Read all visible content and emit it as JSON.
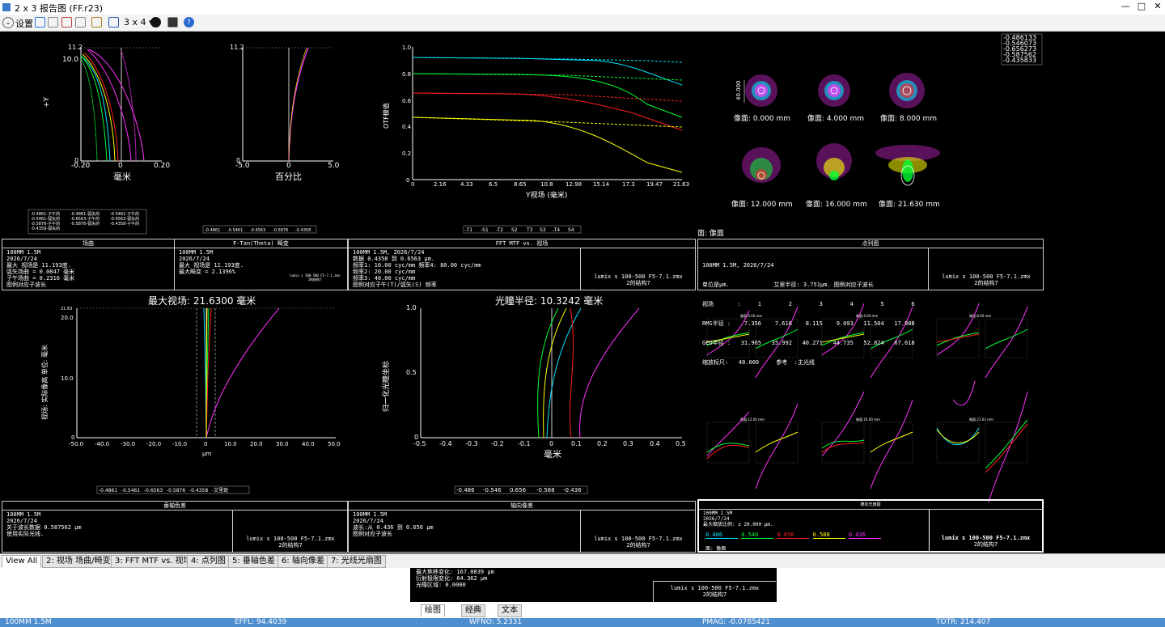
{
  "window": {
    "title": "2 x 3 报告图 (FF.r23)",
    "min": "—",
    "max": "□",
    "close": "✕"
  },
  "toolbar": {
    "settings": "设置",
    "layout": "3 x 4 ▾"
  },
  "p_fc": {
    "ytop": "11.2",
    "y10": "10.0",
    "y0": "0",
    "ylabel": "+Y",
    "xl": "-0.20",
    "xm": "0",
    "xr": "0.20",
    "xunit": "毫米",
    "legend": [
      "-0.4861-子午的",
      "-0.4861-弧矢的",
      "-0.5461-子午的",
      "-0.5461-弧矢的",
      "-0.6563-子午的",
      "-0.6563-弧矢的",
      "-0.5876-子午的",
      "-0.5876-弧矢的",
      "-0.4358-子午的",
      "-0.4358-弧矢的"
    ]
  },
  "p_dist": {
    "ytop": "11.2",
    "y0": "0",
    "xl": "-5.0",
    "xm": "0",
    "xr": "5.0",
    "xunit": "百分比",
    "legend": [
      "-0.4861",
      "-0.5461",
      "-0.6563",
      "-0.5876",
      "-0.4358"
    ]
  },
  "p_mtf": {
    "yticks": [
      "1.0",
      "0.8",
      "0.6",
      "0.4",
      "0.2",
      "0"
    ],
    "xticks": [
      "0",
      "2.16",
      "4.33",
      "6.5",
      "8.65",
      "10.8",
      "12.98",
      "15.14",
      "17.3",
      "19.47",
      "21.63"
    ],
    "ylabel": "OTF模值",
    "xlabel": "Y视场 (毫米)",
    "legend": [
      "-T1",
      "-S1",
      "-T2",
      "S2",
      "T3",
      "S3",
      "-T4",
      "S4"
    ]
  },
  "p_spot": {
    "wavelegend": [
      "-0.486133",
      "-0.546073",
      "-0.656273",
      "-0.587562",
      "-0.435833"
    ],
    "scale": "40.000",
    "fields": [
      "像面: 0.000 mm",
      "像面: 4.000 mm",
      "像面: 8.000 mm",
      "像面: 12.000 mm",
      "像面: 16.000 mm",
      "像面: 21.630 mm"
    ],
    "surface_label": "面: 像面"
  },
  "info_fc": {
    "head1": "场曲",
    "head2": "F-Tan(Theta) 畸变",
    "left": [
      "100MM 1.5M",
      "2026/7/24",
      "最大 视场是 11.193度.",
      "弧矢场曲 = 0.0847 毫米",
      "子午场曲 = 0.2316 毫米",
      "图例对应子波长"
    ],
    "right": [
      "100MM 1.5M",
      "2026/7/24",
      "最大 视场是 11.193度.",
      "最大畸变 = 2.1396%"
    ],
    "lens": "lumix s 100-500 F5-7.1.zmx",
    "config": "2的结构7"
  },
  "info_mtf": {
    "head": "FFT MTF vs. 视场",
    "lines": [
      "100MM 1.5M, 2026/7/24",
      "数据 0.4358 到 0.6563 μm.",
      "频率1:   10.00 cyc/mm  频率4:   80.00 cyc/mm",
      "频率2:   20.00 cyc/mm",
      "频率3:   40.00 cyc/mm",
      "图例对应子午(T)/弧矢(S) 频率"
    ],
    "lens": "lumix s 100-500 F5-7.1.zmx",
    "config": "2的结构7"
  },
  "info_spot": {
    "head": "点列图",
    "lines": [
      "100MM 1.5M, 2026/7/24",
      "单位是μm.             艾里半径: 3.751μm. 图例对应子波长",
      "视场       :     1        2        3        4        5        6",
      "RMS半径 :    7.356    7.616    8.115    9.093   11.504   17.988",
      "GEO半径 :   31.965   35.992   40.271   44.735   52.824   67.618",
      "缩放标尺:   40.000     参考  :主光线"
    ],
    "lens": "lumix s 100-500 F5-7.1.zmx",
    "config": "2的结构7"
  },
  "p_lat": {
    "title": "最大视场: 21.6300 毫米",
    "ytop": "21.63",
    "y20": "20.0",
    "y10": "10.0",
    "y0": "0",
    "ylabel": "视场: 实际像高 单位: 毫米",
    "xticks": [
      "-50.0",
      "-40.0",
      "-30.0",
      "-20.0",
      "-10.0",
      "0",
      "10.0",
      "20.0",
      "30.0",
      "40.0",
      "50.0"
    ],
    "xunit": "μm",
    "legend": [
      "-0.4861",
      "-0.5461",
      "-0.6563",
      "-0.5876",
      "-0.4358",
      "-艾里斑"
    ]
  },
  "p_axial": {
    "title": "光瞳半径: 10.3242 毫米",
    "yticks": [
      "1.0",
      "0.5",
      "0"
    ],
    "ylabel": "归一化光瞳坐标",
    "xticks": [
      "-0.5",
      "-0.4",
      "-0.3",
      "-0.2",
      "-0.1",
      "0",
      "0.1",
      "0.2",
      "0.3",
      "0.4",
      "0.5"
    ],
    "xunit": "毫米",
    "legend": [
      "-0.486",
      "-0.546",
      "0.656",
      "-0.588",
      "-0.436"
    ]
  },
  "p_fan": {
    "fields": [
      "像面:0.00 mm",
      "像面:4.00 mm",
      "像面:8.00 mm",
      "像面:12.00 mm",
      "像面:16.00 mm",
      "像面:21.63 mm"
    ]
  },
  "info_lat": {
    "head": "垂轴色差",
    "lines": [
      "100MM 1.5M",
      "2026/7/24",
      "关于波长数据 0.587562 μm",
      "使用实际光线."
    ],
    "lens": "lumix s 100-500 F5-7.1.zmx",
    "config": "2的结构7"
  },
  "info_axial": {
    "head": "轴向像差",
    "lines": [
      "100MM 1.5M",
      "2026/7/24",
      "波长:从 0.436 到 0.656 μm",
      "图例对应子波长"
    ],
    "lens": "lumix s 100-500 F5-7.1.zmx",
    "config": "2的结构7"
  },
  "info_fan": {
    "head": "横向光扇图",
    "lines": [
      "100MM 1.5M",
      "2026/7/24",
      "最大缩放比例: ± 20.000 μm."
    ],
    "waves": [
      "0.486",
      "0.546",
      "0.656",
      "0.588",
      "0.436"
    ],
    "surface": "面: 像面",
    "lens": "lumix s 100-500 F5-7.1.zmx",
    "config": "2的结构7"
  },
  "tabs": [
    "View All",
    "2: 视场 场曲/畸变",
    "3: FFT MTF vs. 视场",
    "4: 点列图",
    "5: 垂轴色差",
    "6: 轴向像差",
    "7: 光线光扇图"
  ],
  "lower": {
    "lines": [
      "最大焦移变化: 167.0839 μm",
      "衍射极限变化: 64.362 μm",
      "光瞳区域: 0.0000"
    ],
    "lens": "lumix s 100-500 F5-7.1.zmx",
    "config": "2的结构7",
    "tabs": [
      "绘图",
      "经典",
      "文本"
    ]
  },
  "status": {
    "s1": "100MM 1.5M",
    "s2": "EFFL: 94.4039",
    "s3": "WFNO: 5.2331",
    "s4": "PMAG: -0.0785421",
    "s5": "TOTR: 214.407"
  },
  "colors": {
    "blue": "#00e5ff",
    "green": "#00ff33",
    "red": "#ff2020",
    "yellow": "#ffff00",
    "magenta": "#ff33ff"
  }
}
